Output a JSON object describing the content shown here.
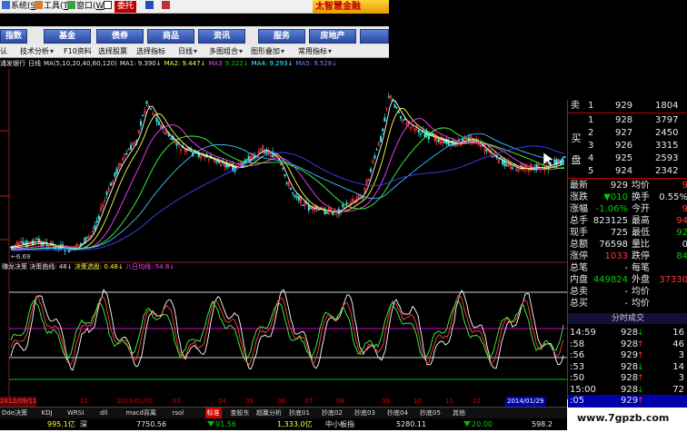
{
  "menu": {
    "items": [
      "系统",
      "工具",
      "窗口"
    ],
    "highlight_tab": "委托",
    "brand": "太智慧金融"
  },
  "nav": [
    "指数",
    "基金",
    "债券",
    "商品",
    "资讯",
    "服务",
    "房地产"
  ],
  "toolbar": [
    "认",
    "技术分析",
    "F10资料",
    "选择股票",
    "选择指标",
    "日线",
    "多图组合",
    "图形叠加",
    "常用指标"
  ],
  "ma_bar": {
    "title": "浦发银行",
    "period": "日线",
    "params": "MA(5,10,20,40,60,120)",
    "ma1": "MA1: 9.390↓",
    "ma2": "MA2: 9.447↓",
    "ma3": "MA3",
    "ma4": "MA4: 9.293↓",
    "ma5": "MA5: 9.528↓",
    "ma3_val": "9.322↓"
  },
  "price_labels": {
    "low_label": "6.69"
  },
  "indicator": {
    "title": "赚龙决策",
    "curve": "决策曲线: 48↓",
    "select": "决策选股: 0.48↓",
    "ma8": "八日均线: 54.8↓"
  },
  "dates": [
    "2012/09/11",
    "12",
    "2013/01/02",
    "03",
    "04",
    "05",
    "06",
    "07",
    "08",
    "09",
    "10",
    "11",
    "12",
    "2014/01/29"
  ],
  "tabs": [
    "Dde决策",
    "KDJ",
    "WRSI",
    "dll",
    "macd背离",
    "rsol",
    "标准",
    "查股东",
    "超赢分析",
    "抄底01",
    "抄底02",
    "抄底03",
    "抄底04",
    "抄底05",
    "其他"
  ],
  "status": {
    "amount1": "995.1亿",
    "market1": "深",
    "index2": "7750.56",
    "chg2": "91.56",
    "amount3": "1,333.0亿",
    "board": "中小板指",
    "index4": "5280.11",
    "chg4": "20.00",
    "index5": "598.2"
  },
  "watermark": "www.7gpzb.com",
  "orderbook": {
    "sell_label": "卖",
    "buy_label": [
      "买",
      "盘"
    ],
    "buy": [
      {
        "lvl": "1",
        "price": "928",
        "vol": "3797"
      },
      {
        "lvl": "2",
        "price": "927",
        "vol": "2450"
      },
      {
        "lvl": "3",
        "price": "926",
        "vol": "3315"
      },
      {
        "lvl": "4",
        "price": "925",
        "vol": "2593"
      },
      {
        "lvl": "5",
        "price": "924",
        "vol": "2342"
      }
    ],
    "sell1": {
      "lvl": "1",
      "price": "929",
      "vol": "1804"
    }
  },
  "quote": [
    {
      "k1": "最新",
      "v1": "929",
      "k2": "均价",
      "v2": "9"
    },
    {
      "k1": "涨跌",
      "v1": "▼010",
      "k2": "换手",
      "v2": "0.55%"
    },
    {
      "k1": "涨幅",
      "v1": "-1.06%",
      "k2": "今开",
      "v2": "9"
    },
    {
      "k1": "总手",
      "v1": "823125",
      "k2": "最高",
      "v2": "94"
    },
    {
      "k1": "现手",
      "v1": "725",
      "k2": "最低",
      "v2": "92"
    },
    {
      "k1": "总额",
      "v1": "76598",
      "k2": "量比",
      "v2": "0"
    },
    {
      "k1": "涨停",
      "v1": "1033",
      "k2": "跌停",
      "v2": "84"
    },
    {
      "k1": "总笔",
      "v1": "-",
      "k2": "每笔",
      "v2": ""
    },
    {
      "k1": "内盘",
      "v1": "449824",
      "k2": "外盘",
      "v2": "37330"
    },
    {
      "k1": "总卖",
      "v1": "-",
      "k2": "均价",
      "v2": ""
    },
    {
      "k1": "总买",
      "v1": "-",
      "k2": "均价",
      "v2": ""
    }
  ],
  "ticks_title": "分时成交",
  "ticks": [
    {
      "t": "14:59",
      "p": "928",
      "dir": "↓",
      "v": "16"
    },
    {
      "t": ":58",
      "p": "928",
      "dir": "↑",
      "v": "46"
    },
    {
      "t": ":56",
      "p": "929",
      "dir": "↑",
      "v": "3"
    },
    {
      "t": ":53",
      "p": "928",
      "dir": "↓",
      "v": "14"
    },
    {
      "t": ":50",
      "p": "928",
      "dir": "↑",
      "v": "3"
    },
    {
      "t": "15:00",
      "p": "928",
      "dir": "↓",
      "v": "72"
    },
    {
      "t": ":05",
      "p": "929",
      "dir": "↑",
      "v": ""
    }
  ],
  "colors": {
    "up": "#ff3c3c",
    "down": "#00d000",
    "nav_blue": "#2a4aa0",
    "tab_red": "#c80000"
  }
}
